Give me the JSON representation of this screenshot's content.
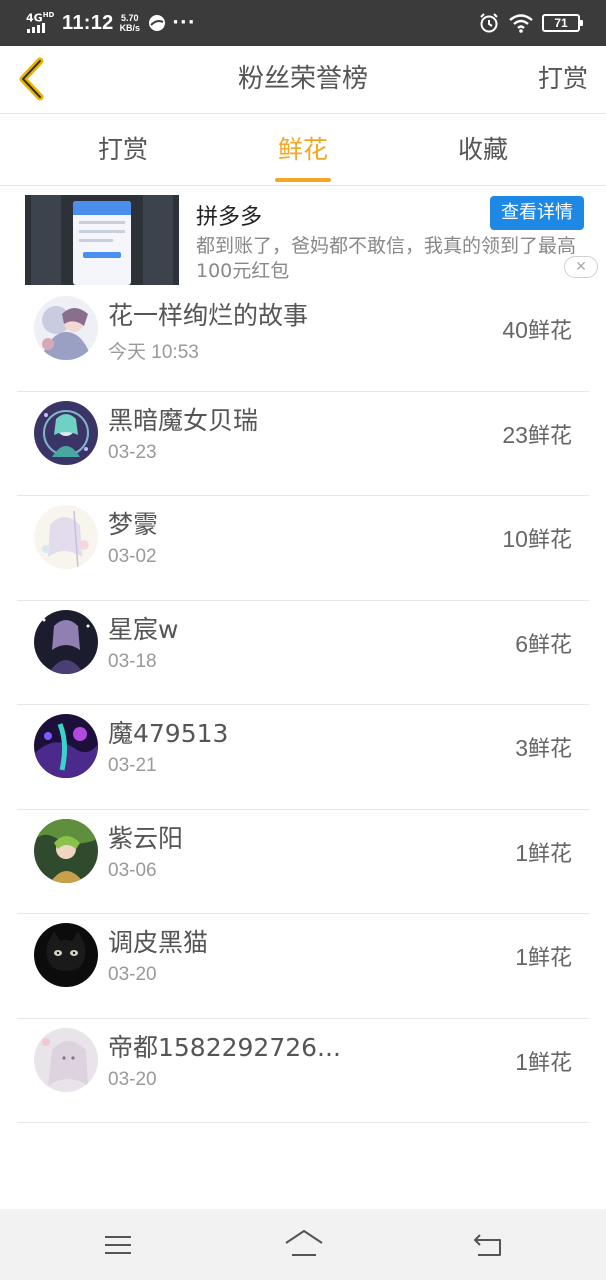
{
  "status_bar": {
    "network": "4G",
    "network_sup": "HD",
    "time": "11:12",
    "speed_value": "5.70",
    "speed_unit": "KB/s",
    "more": "···",
    "battery": "71",
    "icons": [
      "signal-icon",
      "app-notification-icon",
      "alarm-icon",
      "wifi-icon",
      "battery-icon"
    ]
  },
  "header": {
    "back_icon": "chevron-left-icon",
    "title": "粉丝荣誉榜",
    "action": "打赏"
  },
  "tabs": [
    {
      "label": "打赏",
      "active": false
    },
    {
      "label": "鲜花",
      "active": true
    },
    {
      "label": "收藏",
      "active": false
    }
  ],
  "accent_color": "#f5a623",
  "ad": {
    "title": "拼多多",
    "cta": "查看详情",
    "description": "都到账了，爸妈都不敢信，我真的领到了最高100元红包",
    "close": "✕",
    "cta_color": "#1e88e5"
  },
  "ranking": [
    {
      "name": "花一样绚烂的故事",
      "date": "今天 10:53",
      "count": "40",
      "unit": "鲜花"
    },
    {
      "name": "黑暗魔女贝瑞",
      "date": "03-23",
      "count": "23",
      "unit": "鲜花"
    },
    {
      "name": "梦霥",
      "date": "03-02",
      "count": "10",
      "unit": "鲜花"
    },
    {
      "name": "星宸w",
      "date": "03-18",
      "count": "6",
      "unit": "鲜花"
    },
    {
      "name": "魔479513",
      "date": "03-21",
      "count": "3",
      "unit": "鲜花"
    },
    {
      "name": "紫云阳",
      "date": "03-06",
      "count": "1",
      "unit": "鲜花"
    },
    {
      "name": "调皮黑猫",
      "date": "03-20",
      "count": "1",
      "unit": "鲜花"
    },
    {
      "name": "帝都1582292726...",
      "date": "03-20",
      "count": "1",
      "unit": "鲜花"
    }
  ],
  "system_nav": {
    "icons": [
      "menu-icon",
      "home-icon",
      "back-icon"
    ]
  }
}
